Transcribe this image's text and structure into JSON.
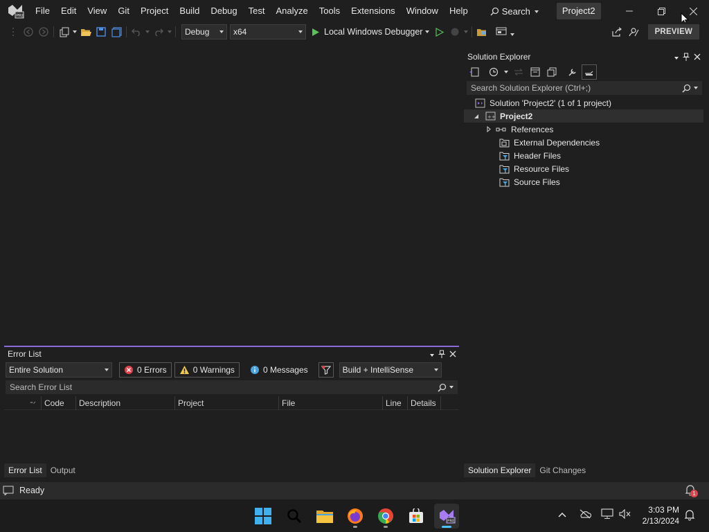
{
  "menu": {
    "items": [
      "File",
      "Edit",
      "View",
      "Git",
      "Project",
      "Build",
      "Debug",
      "Test",
      "Analyze",
      "Tools",
      "Extensions",
      "Window",
      "Help"
    ],
    "search_label": "Search",
    "project_name": "Project2"
  },
  "toolbar": {
    "configuration": "Debug",
    "platform": "x64",
    "debugger_label": "Local Windows Debugger",
    "preview_label": "PREVIEW"
  },
  "error_list": {
    "title": "Error List",
    "scope": "Entire Solution",
    "errors_label": "0 Errors",
    "warnings_label": "0 Warnings",
    "messages_label": "0 Messages",
    "source_filter": "Build + IntelliSense",
    "search_placeholder": "Search Error List",
    "columns": [
      "Code",
      "Description",
      "Project",
      "File",
      "Line",
      "Details"
    ]
  },
  "bottom_tabs": [
    "Error List",
    "Output"
  ],
  "solution_explorer": {
    "title": "Solution Explorer",
    "search_placeholder": "Search Solution Explorer (Ctrl+;)",
    "solution_label": "Solution 'Project2' (1 of 1 project)",
    "project_label": "Project2",
    "nodes": [
      "References",
      "External Dependencies",
      "Header Files",
      "Resource Files",
      "Source Files"
    ]
  },
  "right_tabs": [
    "Solution Explorer",
    "Git Changes"
  ],
  "status": {
    "text": "Ready",
    "notification_count": "1"
  },
  "taskbar": {
    "time": "3:03 PM",
    "date": "2/13/2024"
  },
  "colors": {
    "accent": "#8c6bd6",
    "play_green": "#5bc15b",
    "error_red": "#e0434b",
    "warning_yellow": "#f2c94c",
    "info_blue": "#4aa3df"
  }
}
